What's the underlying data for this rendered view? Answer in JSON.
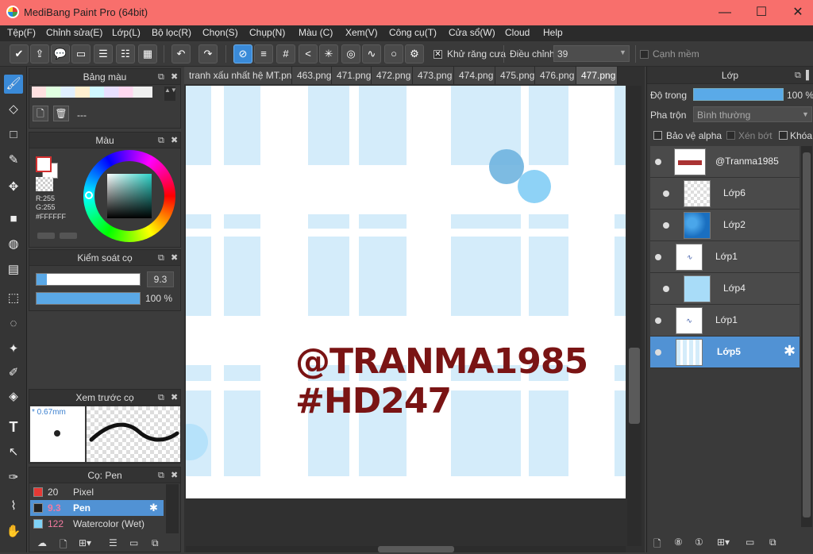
{
  "window": {
    "title": "MediBang Paint Pro (64bit)",
    "minimize": "—",
    "maximize": "☐",
    "close": "✕"
  },
  "menu": [
    "Tệp(F)",
    "Chỉnh sửa(E)",
    "Lớp(L)",
    "Bộ lọc(R)",
    "Chọn(S)",
    "Chụp(N)",
    "Màu (C)",
    "Xem(V)",
    "Công cụ(T)",
    "Cửa sổ(W)",
    "Cloud",
    "Help"
  ],
  "toolbar": {
    "antialias_label": "Khử răng cưa",
    "correction_label": "Điều chỉnh",
    "correction_value": "39",
    "soft_edge_label": "Cạnh mềm"
  },
  "panels": {
    "palette": {
      "title": "Bảng màu",
      "list_value": "---"
    },
    "color": {
      "title": "Màu",
      "r": "R:255",
      "g": "G:255",
      "hex": "#FFFFFF"
    },
    "brush_control": {
      "title": "Kiểm soát cọ",
      "size": "9.3",
      "opacity": "100 %",
      "size_fraction": 0.1,
      "opacity_fraction": 1.0
    },
    "brush_preview": {
      "title": "Xem trước cọ",
      "size": "* 0.67mm"
    },
    "brushes": {
      "title": "Cọ: Pen",
      "items": [
        {
          "size": "20",
          "name": "Pixel",
          "color": "#e53935"
        },
        {
          "size": "9.3",
          "name": "Pen",
          "color": "#222222"
        },
        {
          "size": "122",
          "name": "Watercolor (Wet)",
          "color": "#7fd3f7"
        }
      ]
    }
  },
  "tabs": [
    "tranh xấu nhất hệ MT.png",
    "463.png",
    "471.png",
    "472.png",
    "473.png",
    "474.png",
    "475.png",
    "476.png",
    "477.png"
  ],
  "canvas": {
    "line1": "@TRANMA1985",
    "line2": "#HD247",
    "text_color": "#7a1414"
  },
  "layers": {
    "title": "Lớp",
    "opacity_label": "Độ trong",
    "opacity_value": "100 %",
    "blend_label": "Pha trộn",
    "blend_value": "Bình thường",
    "protect_alpha": "Bảo vệ alpha",
    "clip": "Xén bớt",
    "lock": "Khóa",
    "items": [
      {
        "name": "@Tranma1985"
      },
      {
        "name": "Lớp6"
      },
      {
        "name": "Lớp2"
      },
      {
        "name": "Lớp1"
      },
      {
        "name": "Lớp4"
      },
      {
        "name": "Lớp1"
      },
      {
        "name": "Lớp5"
      }
    ]
  },
  "colors": {
    "accent": "#5192d4",
    "titlebar": "#f86f6c"
  }
}
